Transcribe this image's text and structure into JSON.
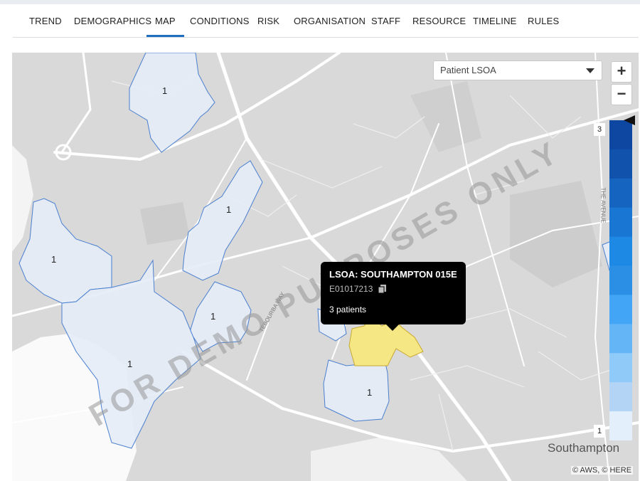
{
  "tabs": [
    {
      "label": "TREND"
    },
    {
      "label": "DEMOGRAPHICS"
    },
    {
      "label": "MAP",
      "active": true
    },
    {
      "label": "CONDITIONS"
    },
    {
      "label": "RISK"
    },
    {
      "label": "ORGANISATION"
    },
    {
      "label": "STAFF"
    },
    {
      "label": "RESOURCE"
    },
    {
      "label": "TIMELINE"
    },
    {
      "label": "RULES"
    }
  ],
  "map": {
    "layer_select": "Patient LSOA",
    "zoom_in": "+",
    "zoom_out": "−",
    "legend": {
      "max": "3",
      "min": "1",
      "colors": [
        "#0d47a1",
        "#1152ad",
        "#1565c0",
        "#1976d2",
        "#1e88e5",
        "#2b8fe6",
        "#42a5f5",
        "#64b5f6",
        "#90caf9",
        "#b3d4f5",
        "#e3effb"
      ]
    },
    "area_counts": [
      "1",
      "1",
      "1",
      "1",
      "1",
      "1",
      "1"
    ],
    "tooltip": {
      "title": "LSOA: SOUTHAMPTON 015E",
      "code": "E01017213",
      "patients": "3 patients"
    },
    "watermark": "FOR DEMO PURPOSES ONLY",
    "place_label": "Southampton",
    "road_labels": [
      "TEBOURBA WAY",
      "THE AVENUE"
    ],
    "attribution": "© AWS, © HERE",
    "colors": {
      "lsoa_fill": "#e5edf7",
      "lsoa_border": "#4a7fd0",
      "highlight": "#f4e784",
      "tab_active": "#1e6fc1"
    }
  }
}
